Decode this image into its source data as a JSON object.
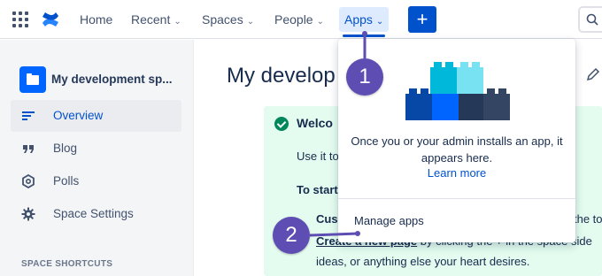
{
  "nav": {
    "items": [
      {
        "label": "Home"
      },
      {
        "label": "Recent"
      },
      {
        "label": "Spaces"
      },
      {
        "label": "People"
      },
      {
        "label": "Apps"
      }
    ],
    "create_label": "+"
  },
  "sidebar": {
    "space_name": "My development sp...",
    "items": [
      {
        "label": "Overview",
        "icon": "overview-lines-icon"
      },
      {
        "label": "Blog",
        "icon": "quote-icon"
      },
      {
        "label": "Polls",
        "icon": "hexagon-icon"
      },
      {
        "label": "Space Settings",
        "icon": "gear-icon"
      }
    ],
    "shortcuts_heading": "SPACE SHORTCUTS"
  },
  "main": {
    "title": "My develop",
    "welcome_heading": "Welco",
    "line1": "Use it to",
    "to_start": "To start",
    "cus": "Cus",
    "create_bold": "Create a new page",
    "create_rest": " by clicking the + in the space side",
    "the_to": "the to",
    "ideas": "ideas, or anything else your heart desires."
  },
  "apps_dropdown": {
    "message": "Once you or your admin installs an app, it appears here.",
    "learn_more": "Learn more",
    "manage_apps": "Manage apps"
  },
  "callouts": [
    {
      "number": "1"
    },
    {
      "number": "2"
    }
  ],
  "colors": {
    "brand": "#0052cc",
    "callout": "#5e4db2",
    "panel_bg": "#e3fcef",
    "success": "#00875a"
  }
}
